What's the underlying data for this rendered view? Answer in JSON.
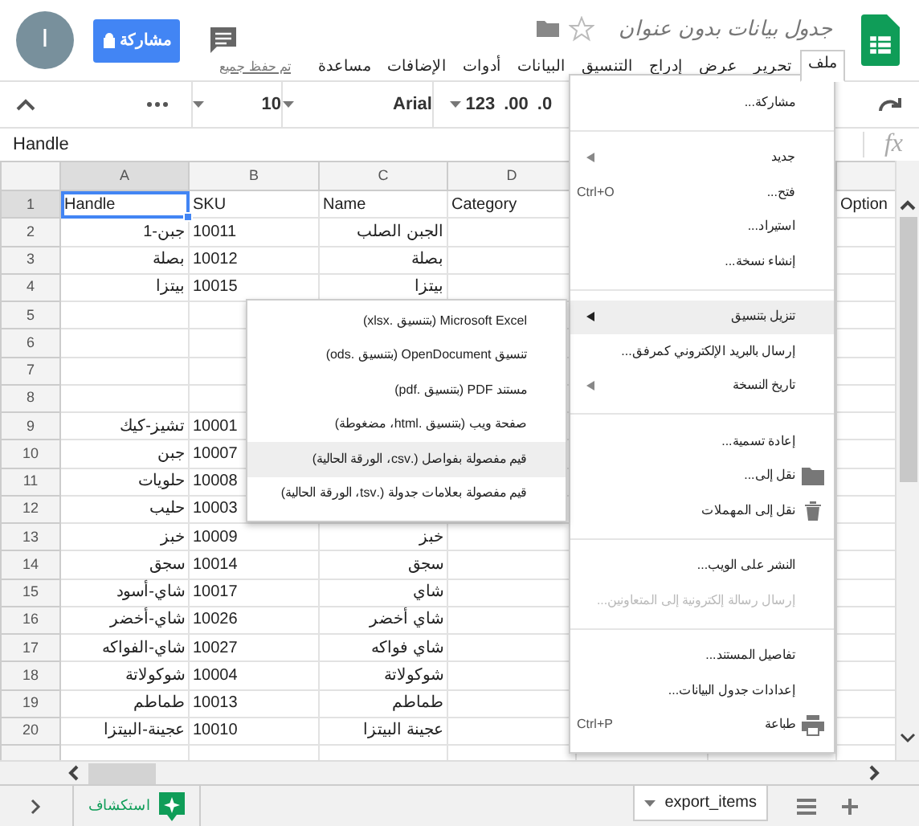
{
  "header": {
    "avatar_letter": "I",
    "share_button": "مشاركة",
    "title": "جدول بيانات بدون عنوان",
    "starred": false,
    "saved_status": "تم حفظ جميع"
  },
  "menu_bar": [
    {
      "label": "ملف",
      "selected": true
    },
    {
      "label": "تحرير",
      "selected": false
    },
    {
      "label": "عرض",
      "selected": false
    },
    {
      "label": "إدراج",
      "selected": false
    },
    {
      "label": "التنسيق",
      "selected": false
    },
    {
      "label": "البيانات",
      "selected": false
    },
    {
      "label": "أدوات",
      "selected": false
    },
    {
      "label": "الإضافات",
      "selected": false
    },
    {
      "label": "مساعدة",
      "selected": false
    }
  ],
  "toolbar": {
    "font_size": "10",
    "font": "Arial",
    "number_format": "123",
    "decimal_increase": ".00",
    "decimal_decrease": ".0"
  },
  "formula_bar": {
    "value": "Handle",
    "fx": "fx"
  },
  "sheet": {
    "column_headers": {
      "a": "A",
      "b": "B",
      "c": "C",
      "d": "D"
    },
    "rows": [
      {
        "number": "1",
        "a": {
          "text": "Handle",
          "selected": true
        },
        "b": {
          "text": "SKU",
          "selected": false
        },
        "c": {
          "text": "Name",
          "selected": false
        },
        "d": {
          "text": "Category",
          "selected": false
        },
        "g": {
          "text": "Option",
          "selected": false
        }
      },
      {
        "number": "2",
        "a": {
          "text": "جبن-1",
          "selected": false
        },
        "b": {
          "text": "10011",
          "selected": false
        },
        "c": {
          "text": "الجبن الصلب",
          "selected": false
        }
      },
      {
        "number": "3",
        "a": {
          "text": "بصلة",
          "selected": false
        },
        "b": {
          "text": "10012",
          "selected": false
        },
        "c": {
          "text": "بصلة",
          "selected": false
        }
      },
      {
        "number": "4",
        "a": {
          "text": "بيتزا",
          "selected": false
        },
        "b": {
          "text": "10015",
          "selected": false
        },
        "c": {
          "text": "بيتزا",
          "selected": false
        }
      },
      {
        "number": "5"
      },
      {
        "number": "6"
      },
      {
        "number": "7"
      },
      {
        "number": "8"
      },
      {
        "number": "9",
        "a": {
          "text": "تشيز-كيك",
          "selected": false
        },
        "b": {
          "text": "10001",
          "selected": false
        }
      },
      {
        "number": "10",
        "a": {
          "text": "جبن",
          "selected": false
        },
        "b": {
          "text": "10007",
          "selected": false
        }
      },
      {
        "number": "11",
        "a": {
          "text": "حلويات",
          "selected": false
        },
        "b": {
          "text": "10008",
          "selected": false
        }
      },
      {
        "number": "12",
        "a": {
          "text": "حليب",
          "selected": false
        },
        "b": {
          "text": "10003",
          "selected": false
        }
      },
      {
        "number": "13",
        "a": {
          "text": "خبز",
          "selected": false
        },
        "b": {
          "text": "10009",
          "selected": false
        },
        "c": {
          "text": "خبز",
          "selected": false
        }
      },
      {
        "number": "14",
        "a": {
          "text": "سجق",
          "selected": false
        },
        "b": {
          "text": "10014",
          "selected": false
        },
        "c": {
          "text": "سجق",
          "selected": false
        }
      },
      {
        "number": "15",
        "a": {
          "text": "شاي-أسود",
          "selected": false
        },
        "b": {
          "text": "10017",
          "selected": false
        },
        "c": {
          "text": "شاي",
          "selected": false
        }
      },
      {
        "number": "16",
        "a": {
          "text": "شاي-أخضر",
          "selected": false
        },
        "b": {
          "text": "10026",
          "selected": false
        },
        "c": {
          "text": "شاي أخضر",
          "selected": false
        }
      },
      {
        "number": "17",
        "a": {
          "text": "شاي-الفواكه",
          "selected": false
        },
        "b": {
          "text": "10027",
          "selected": false
        },
        "c": {
          "text": "شاي فواكه",
          "selected": false
        }
      },
      {
        "number": "18",
        "a": {
          "text": "شوكولاتة",
          "selected": false
        },
        "b": {
          "text": "10004",
          "selected": false
        },
        "c": {
          "text": "شوكولاتة",
          "selected": false
        }
      },
      {
        "number": "19",
        "a": {
          "text": "طماطم",
          "selected": false
        },
        "b": {
          "text": "10013",
          "selected": false
        },
        "c": {
          "text": "طماطم",
          "selected": false
        }
      },
      {
        "number": "20",
        "a": {
          "text": "عجينة-البيتزا",
          "selected": false
        },
        "b": {
          "text": "10010",
          "selected": false
        },
        "c": {
          "text": "عجينة البيتزا",
          "selected": false
        }
      }
    ]
  },
  "file_menu": [
    {
      "kind": "item",
      "label": "مشاركة...",
      "selected": false,
      "disabled": false
    },
    {
      "kind": "separator"
    },
    {
      "kind": "item",
      "label": "جديد",
      "submenu": true,
      "selected": false,
      "disabled": false
    },
    {
      "kind": "item",
      "label": "فتح...",
      "shortcut": "Ctrl+O",
      "selected": false,
      "disabled": false
    },
    {
      "kind": "item",
      "label": "استيراد...",
      "selected": false,
      "disabled": false
    },
    {
      "kind": "item",
      "label": "إنشاء نسخة...",
      "selected": false,
      "disabled": false
    },
    {
      "kind": "separator"
    },
    {
      "kind": "item",
      "label": "تنزيل بتنسيق",
      "submenu": true,
      "selected": true,
      "disabled": false
    },
    {
      "kind": "item",
      "label": "إرسال بالبريد الإلكتروني كمرفق...",
      "selected": false,
      "disabled": false
    },
    {
      "kind": "item",
      "label": "تاريخ النسخة",
      "submenu": true,
      "selected": false,
      "disabled": false
    },
    {
      "kind": "separator"
    },
    {
      "kind": "item",
      "label": "إعادة تسمية...",
      "selected": false,
      "disabled": false
    },
    {
      "kind": "move",
      "label": "نقل إلى...",
      "selected": false,
      "disabled": false
    },
    {
      "kind": "trash",
      "label": "نقل إلى المهملات",
      "selected": false,
      "disabled": false
    },
    {
      "kind": "separator"
    },
    {
      "kind": "item",
      "label": "النشر على الويب...",
      "selected": false,
      "disabled": false
    },
    {
      "kind": "item",
      "label": "إرسال رسالة إلكترونية إلى المتعاونين...",
      "selected": false,
      "disabled": true
    },
    {
      "kind": "separator"
    },
    {
      "kind": "item",
      "label": "تفاصيل المستند...",
      "selected": false,
      "disabled": false
    },
    {
      "kind": "item",
      "label": "إعدادات جدول البيانات...",
      "selected": false,
      "disabled": false
    },
    {
      "kind": "print",
      "label": "طباعة",
      "shortcut": "Ctrl+P",
      "selected": false,
      "disabled": false
    }
  ],
  "download_submenu": [
    {
      "label": "Microsoft Excel (بتنسيق .xlsx)",
      "selected": false
    },
    {
      "label": "تنسيق OpenDocument (بتنسيق .ods)",
      "selected": false
    },
    {
      "label": "مستند PDF (بتنسيق .pdf)",
      "selected": false
    },
    {
      "label": "صفحة ويب (بتنسيق .html، مضغوطة)",
      "selected": false
    },
    {
      "label": "قيم مفصولة بفواصل (.csv، الورقة الحالية)",
      "selected": true
    },
    {
      "label": "قيم مفصولة بعلامات جدولة (.tsv، الورقة الحالية)",
      "selected": false
    }
  ],
  "bottom_bar": {
    "explore_label": "استكشاف",
    "sheet_tabs": [
      {
        "label": "export_items",
        "selected": true
      }
    ]
  }
}
